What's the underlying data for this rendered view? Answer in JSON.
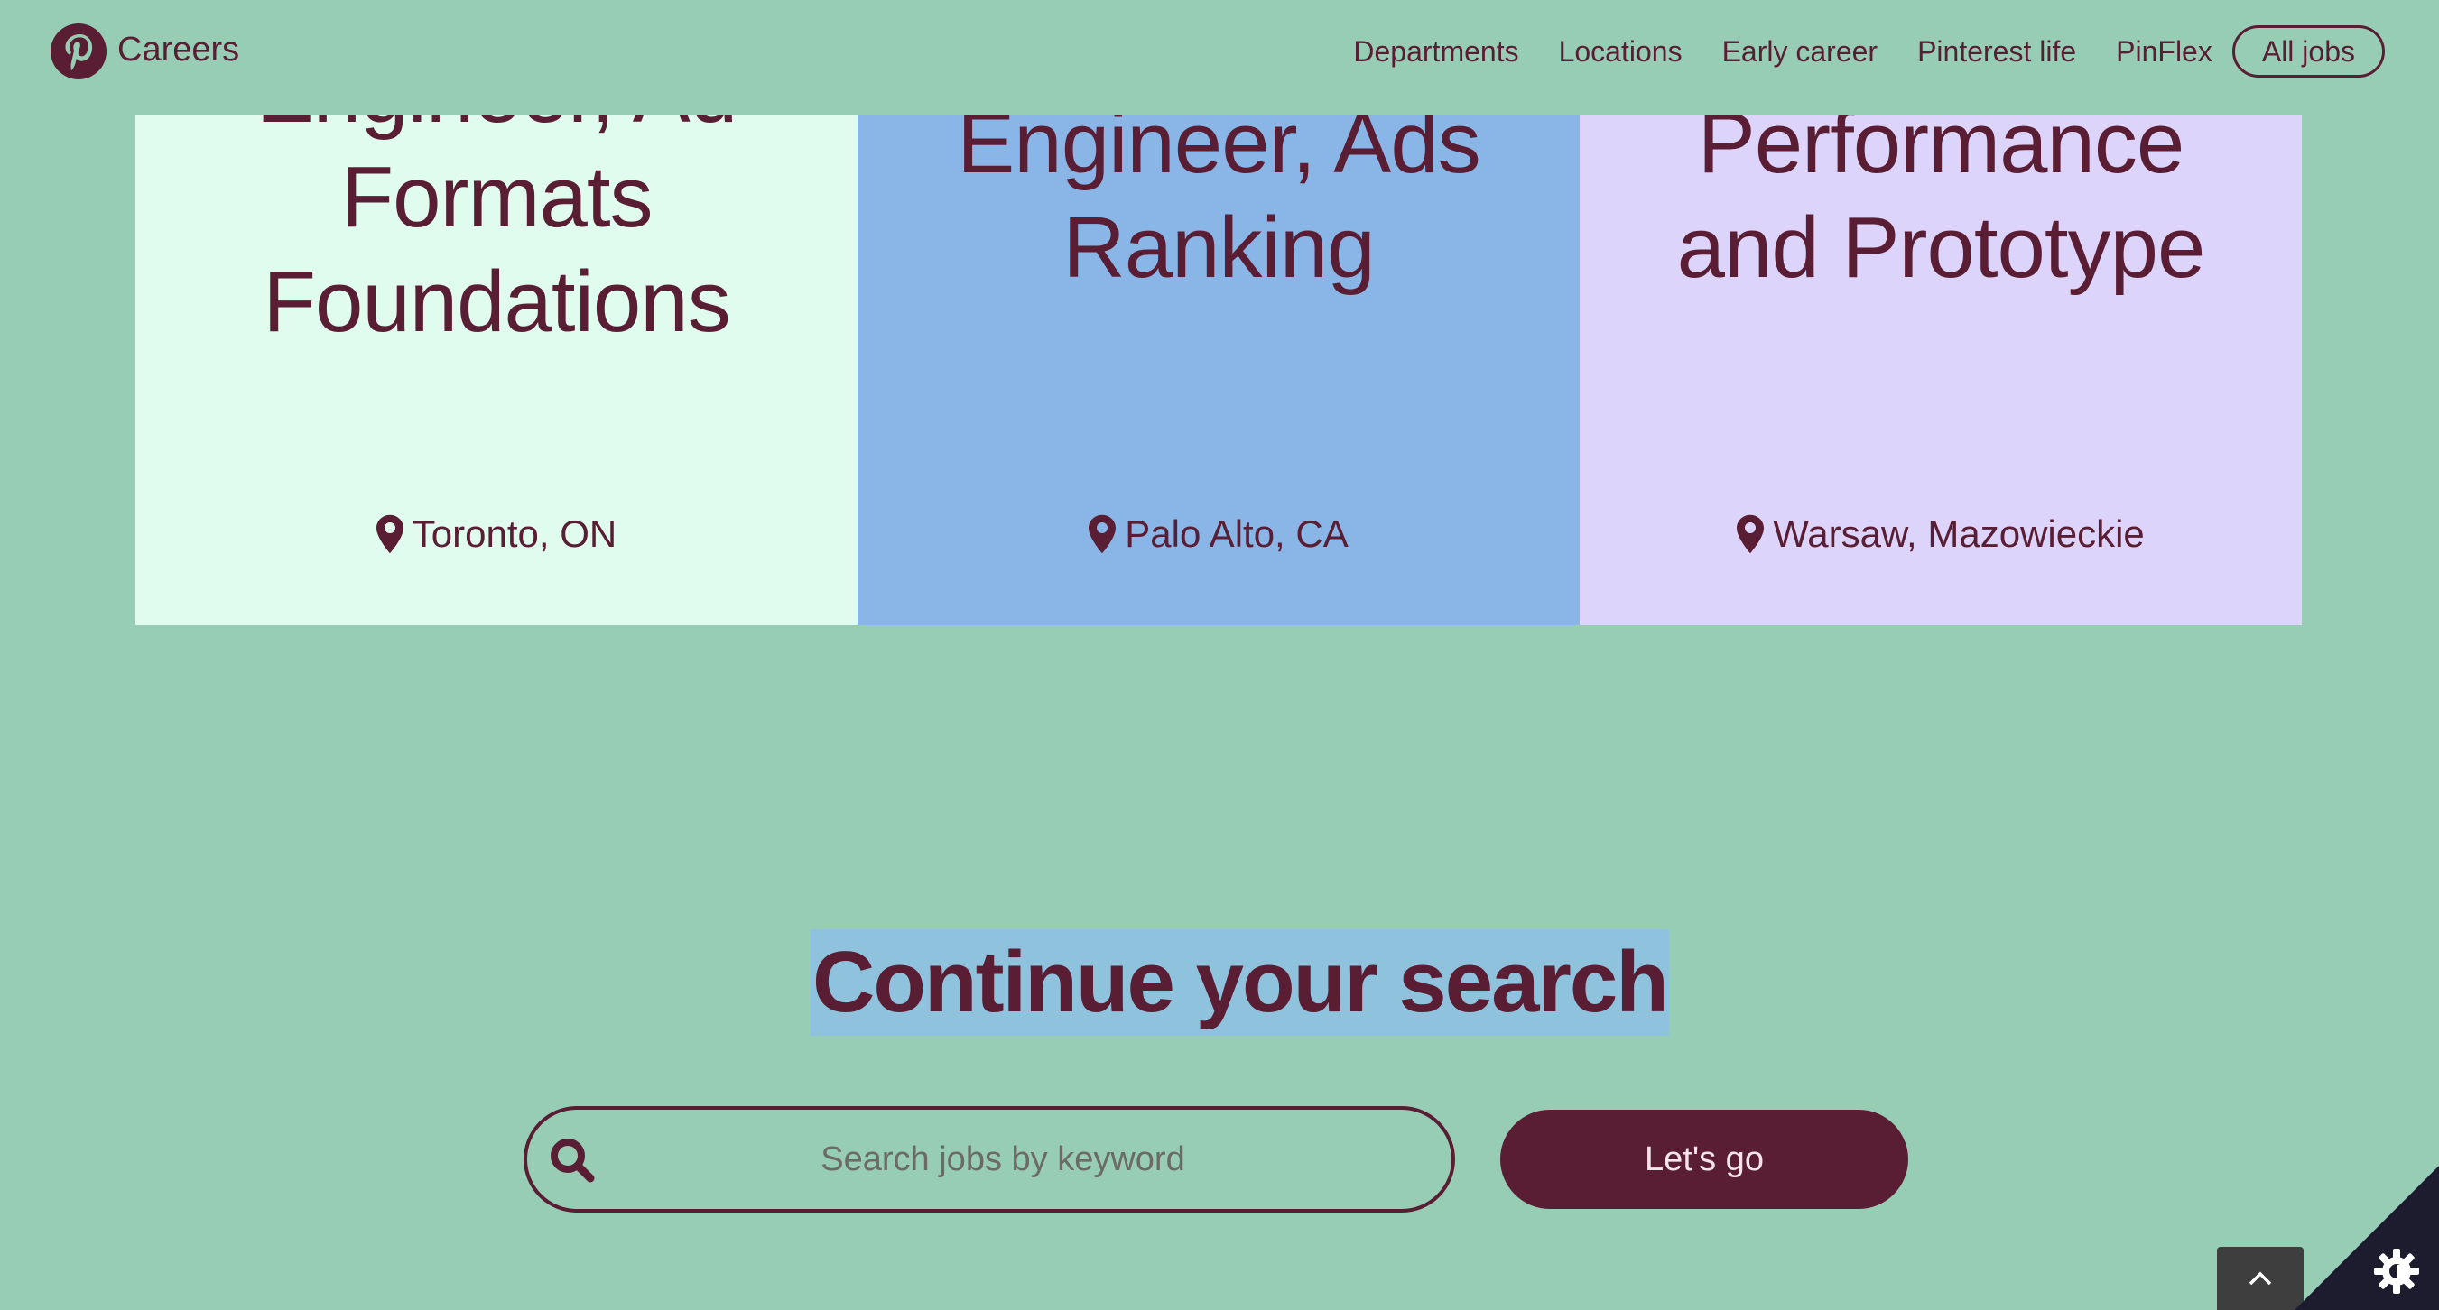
{
  "header": {
    "brand": "Careers",
    "nav": [
      "Departments",
      "Locations",
      "Early career",
      "Pinterest life",
      "PinFlex"
    ],
    "all_jobs": "All jobs"
  },
  "cards": [
    {
      "title": [
        "Engineer, Ad",
        "Formats",
        "Foundations"
      ],
      "location": "Toronto, ON",
      "color": "#e0fcef"
    },
    {
      "title": [
        "Engineer, Ads",
        "Ranking"
      ],
      "location": "Palo Alto, CA",
      "color": "#89b6e6"
    },
    {
      "title": [
        "Performance",
        "and Prototype"
      ],
      "location": "Warsaw, Mazowieckie",
      "color": "#dcd4fb"
    }
  ],
  "section": {
    "heading": "Continue your search",
    "search_placeholder": "Search jobs by keyword",
    "search_value": "",
    "button": "Let's go"
  },
  "colors": {
    "background": "#97cdb5",
    "brand": "#5a1e34",
    "highlight": "#8fc3dd"
  },
  "icons": [
    "pinterest-logo-icon",
    "location-pin-icon",
    "search-icon",
    "chevron-up-icon",
    "gear-icon"
  ]
}
